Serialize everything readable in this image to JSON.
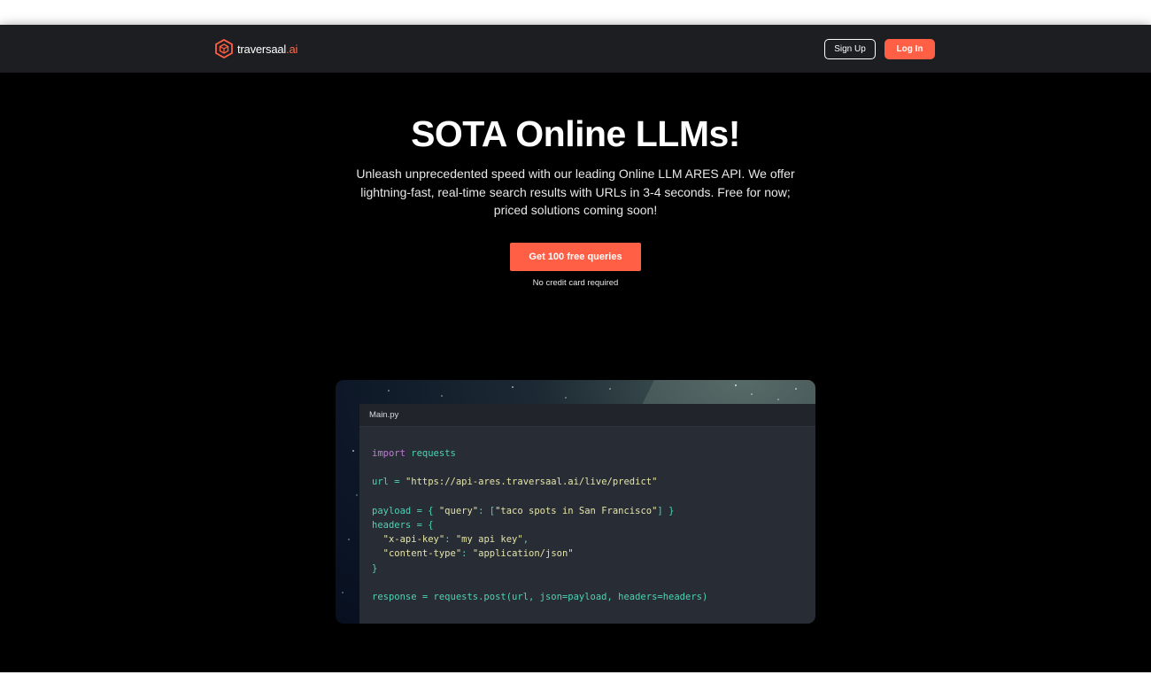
{
  "brand": {
    "name_main": "traversaal",
    "name_accent": ".ai",
    "accent_color": "#ff5f45"
  },
  "nav": {
    "signup_label": "Sign Up",
    "login_label": "Log In"
  },
  "hero": {
    "title": "SOTA Online LLMs!",
    "subtitle": "Unleash unprecedented speed with our leading Online LLM ARES API. We offer lightning-fast, real-time search results with URLs in 3-4 seconds. Free for now; priced solutions coming soon!",
    "cta_label": "Get 100 free queries",
    "cta_note": "No credit card required"
  },
  "code_sample": {
    "filename": "Main.py",
    "lines": {
      "l1_kw": "import",
      "l1_rest": " requests",
      "l3_a": "url = ",
      "l3_str": "\"https://api-ares.traversaal.ai/live/predict\"",
      "l5_a": "payload = { ",
      "l5_str1": "\"query\"",
      "l5_b": ": [",
      "l5_str2": "\"taco spots in San Francisco\"",
      "l5_c": "] }",
      "l6": "headers = {",
      "l7_str1": "  \"x-api-key\"",
      "l7_b": ": ",
      "l7_str2": "\"my api key\"",
      "l7_c": ",",
      "l8_str1": "  \"content-type\"",
      "l8_b": ": ",
      "l8_str2": "\"application/json\"",
      "l9": "}",
      "l11": "response = requests.post(url, json=payload, headers=headers)"
    }
  },
  "icons": {
    "logo": "hexagon-cube-logo-icon"
  }
}
